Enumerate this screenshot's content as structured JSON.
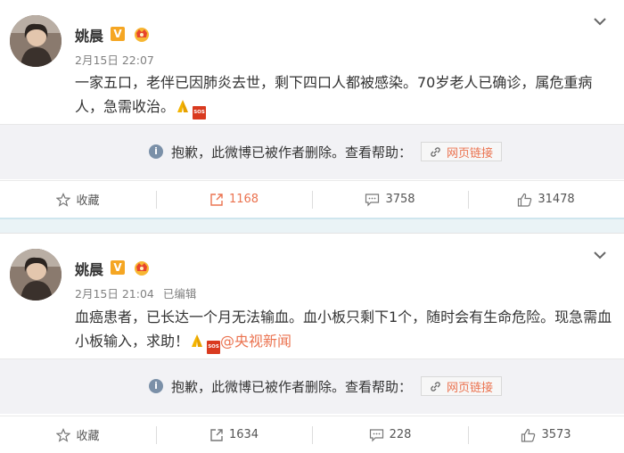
{
  "posts": [
    {
      "username": "姚晨",
      "verified_badge": "V",
      "timestamp": "2月15日 22:07",
      "edited": "",
      "text": "一家五口，老伴已因肺炎去世，剩下四口人都被感染。70岁老人已确诊，属危重病人，急需收治。",
      "emojis": [
        "pray",
        "sos"
      ],
      "mention": "",
      "deleted_notice": "抱歉，此微博已被作者删除。查看帮助：",
      "link_label": "网页链接",
      "actions": {
        "favorite": "收藏",
        "repost": "1168",
        "comment": "3758",
        "like": "31478"
      }
    },
    {
      "username": "姚晨",
      "verified_badge": "V",
      "timestamp": "2月15日 21:04",
      "edited": "已编辑",
      "text": "血癌患者，已长达一个月无法输血。血小板只剩下1个，随时会有生命危险。现急需血小板输入，求助！",
      "emojis": [
        "pray",
        "sos"
      ],
      "mention": "@央视新闻",
      "deleted_notice": "抱歉，此微博已被作者删除。查看帮助：",
      "link_label": "网页链接",
      "actions": {
        "favorite": "收藏",
        "repost": "1634",
        "comment": "228",
        "like": "3573"
      }
    }
  ],
  "sos_label": "SOS",
  "colors": {
    "accent": "#eb7350",
    "badge": "#f5a623",
    "deleted_bg": "#f2f2f5",
    "separator": "#eaf3f6"
  }
}
